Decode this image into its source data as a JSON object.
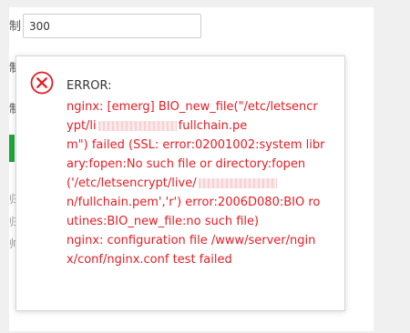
{
  "form": {
    "label_char_1": "制",
    "label_char_2": "制",
    "label_char_3": "制",
    "limit_value": "300",
    "hint_chars": [
      "归",
      "归",
      "帅"
    ]
  },
  "dialog": {
    "icon": "close-circle-icon",
    "title": "ERROR:",
    "line_1": "nginx: [emerg] BIO_new_file(\"/etc/letsencr",
    "line_2_start": "ypt/li",
    "line_2_end": "fullchain.pe",
    "line_3": "m\") failed (SSL: error:02001002:system libr",
    "line_4": "ary:fopen:No such file or directory:fopen",
    "line_5_start": "('/etc/letsencrypt/live/",
    "line_5_end": "",
    "line_6": "n/fullchain.pem','r') error:2006D080:BIO ro",
    "line_7": "utines:BIO_new_file:no such file)",
    "line_8": "nginx: configuration file /www/server/ngin",
    "line_9": "x/conf/nginx.conf test failed"
  },
  "colors": {
    "error_red": "#e51c23",
    "accent_green": "#20a53a"
  }
}
